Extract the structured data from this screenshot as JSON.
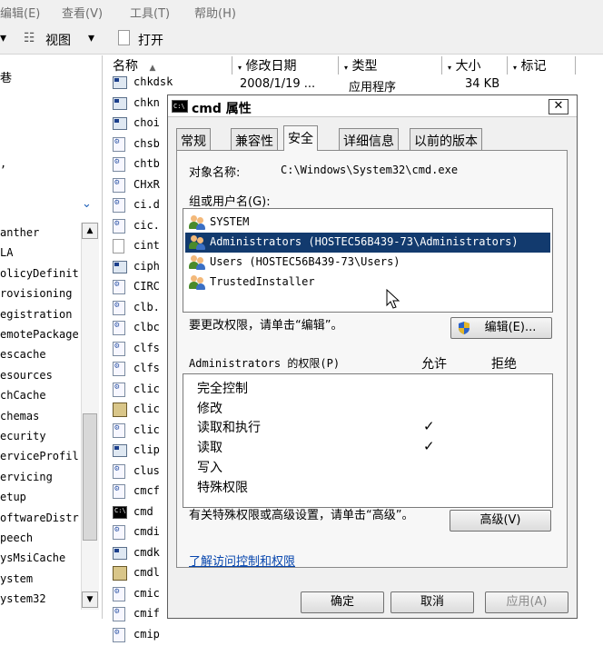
{
  "menu": [
    "编辑(E)",
    "查看(V)",
    "工具(T)",
    "帮助(H)"
  ],
  "toolbar": {
    "views_label": "视图",
    "open_label": "打开"
  },
  "tree": [
    "anther",
    "LA",
    "olicyDefinit",
    "rovisioning",
    "egistration",
    "emotePackage",
    "escache",
    "esources",
    "chCache",
    "chemas",
    "ecurity",
    "erviceProfil",
    "ervicing",
    "etup",
    "oftwareDistr",
    "peech",
    "ysMsiCache",
    "ystem",
    "ystem32"
  ],
  "columns": [
    "名称",
    "修改日期",
    "类型",
    "大小",
    "标记"
  ],
  "files": [
    {
      "name": "chkdsk",
      "date": "2008/1/19 ...",
      "type": "应用程序",
      "size": "34 KB",
      "icon": "exe-icon"
    },
    {
      "name": "chkn",
      "icon": "exe-icon"
    },
    {
      "name": "choi",
      "icon": "exe-icon"
    },
    {
      "name": "chsb",
      "icon": "dll-icon"
    },
    {
      "name": "chtb",
      "icon": "dll-icon"
    },
    {
      "name": "CHxR",
      "icon": "dll-icon"
    },
    {
      "name": "ci.d",
      "icon": "dll-icon"
    },
    {
      "name": "cic.",
      "icon": "dll-icon"
    },
    {
      "name": "cint",
      "icon": "doc-icon"
    },
    {
      "name": "ciph",
      "icon": "exe-icon"
    },
    {
      "name": "CIRC",
      "icon": "dll-icon"
    },
    {
      "name": "clb.",
      "icon": "dll-icon"
    },
    {
      "name": "clbc",
      "icon": "dll-icon"
    },
    {
      "name": "clfs",
      "icon": "dll-icon"
    },
    {
      "name": "clfs",
      "icon": "dll-icon"
    },
    {
      "name": "clic",
      "icon": "dll-icon"
    },
    {
      "name": "clic",
      "icon": "app-icon"
    },
    {
      "name": "clic",
      "icon": "dll-icon"
    },
    {
      "name": "clip",
      "icon": "exe-icon"
    },
    {
      "name": "clus",
      "icon": "dll-icon"
    },
    {
      "name": "cmcf",
      "icon": "dll-icon"
    },
    {
      "name": "cmd",
      "icon": "cmd-icon"
    },
    {
      "name": "cmdi",
      "icon": "dll-icon"
    },
    {
      "name": "cmdk",
      "icon": "exe-icon"
    },
    {
      "name": "cmdl",
      "icon": "app-icon"
    },
    {
      "name": "cmic",
      "icon": "dll-icon"
    },
    {
      "name": "cmif",
      "icon": "dll-icon"
    },
    {
      "name": "cmip",
      "icon": "dll-icon"
    }
  ],
  "dialog": {
    "title": "cmd 属性",
    "close": "✕",
    "tabs": [
      "常规",
      "兼容性",
      "安全",
      "详细信息",
      "以前的版本"
    ],
    "active_tab": "安全",
    "object_label": "对象名称:",
    "object_value": "C:\\Windows\\System32\\cmd.exe",
    "group_label": "组或用户名(G):",
    "groups": [
      "SYSTEM",
      "Administrators (HOSTEC56B439-73\\Administrators)",
      "Users (HOSTEC56B439-73\\Users)",
      "TrustedInstaller"
    ],
    "selected_group": "Administrators (HOSTEC56B439-73\\Administrators)",
    "change_text": "要更改权限，请单击“编辑”。",
    "edit_button": "编辑(E)...",
    "perm_header": "Administrators 的权限(P)",
    "allow_header": "允许",
    "deny_header": "拒绝",
    "permissions": [
      {
        "name": "完全控制",
        "allow": ""
      },
      {
        "name": "修改",
        "allow": ""
      },
      {
        "name": "读取和执行",
        "allow": "✓"
      },
      {
        "name": "读取",
        "allow": "✓"
      },
      {
        "name": "写入",
        "allow": ""
      },
      {
        "name": "特殊权限",
        "allow": ""
      }
    ],
    "special_text": "有关特殊权限或高级设置，请单击“高级”。",
    "advanced_button": "高级(V)",
    "link": "了解访问控制和权限",
    "ok": "确定",
    "cancel": "取消",
    "apply": "应用(A)"
  },
  "colors": {
    "selection": "#123a6e",
    "link": "#0645ad"
  }
}
